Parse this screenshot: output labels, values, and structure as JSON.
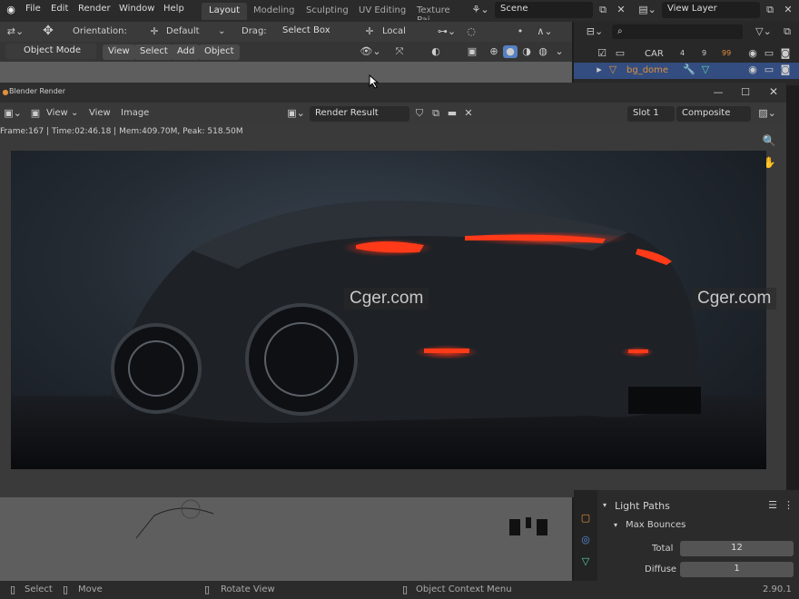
{
  "menubar": {
    "items": [
      "File",
      "Edit",
      "Render",
      "Window",
      "Help"
    ],
    "tabs": [
      "Layout",
      "Modeling",
      "Sculpting",
      "UV Editing",
      "Texture Pai"
    ],
    "scene": "Scene",
    "view_layer": "View Layer"
  },
  "toolbar": {
    "orientation_label": "Orientation:",
    "orientation_value": "Default",
    "drag_label": "Drag:",
    "drag_value": "Select Box",
    "pivot_value": "Local"
  },
  "viewport_header": {
    "mode": "Object Mode",
    "menus": [
      "View",
      "Select",
      "Add",
      "Object"
    ]
  },
  "outliner": {
    "items": [
      {
        "label": "CAR",
        "badge1": "4",
        "badge2": "9",
        "badge3": "99"
      },
      {
        "label": "bg_dome",
        "selected": true
      }
    ]
  },
  "render_window": {
    "title": "Blender Render",
    "menus": [
      "View",
      "View",
      "Image"
    ],
    "image_name": "Render Result",
    "slot": "Slot 1",
    "pass": "Composite",
    "stats": "Frame:167 | Time:02:46.18 | Mem:409.70M, Peak: 518.50M"
  },
  "watermarks": [
    "Cger.com",
    "Cger.com"
  ],
  "properties": {
    "section": "Light Paths",
    "subsection": "Max Bounces",
    "rows": [
      {
        "label": "Total",
        "value": "12"
      },
      {
        "label": "Diffuse",
        "value": "1"
      }
    ]
  },
  "statusbar": {
    "items": [
      "Select",
      "Move",
      "Rotate View",
      "Object Context Menu"
    ],
    "version": "2.90.1"
  },
  "colors": {
    "accent_blue": "#4772b3",
    "selected_row": "#334d80",
    "taillight": "#ff2a10",
    "bg": "#1d1d1d"
  },
  "icons": [
    "blender-logo-icon",
    "eye-icon",
    "camera-icon",
    "monitor-icon",
    "zoom-icon",
    "hand-icon",
    "close-icon",
    "maximize-icon",
    "minimize-icon"
  ]
}
